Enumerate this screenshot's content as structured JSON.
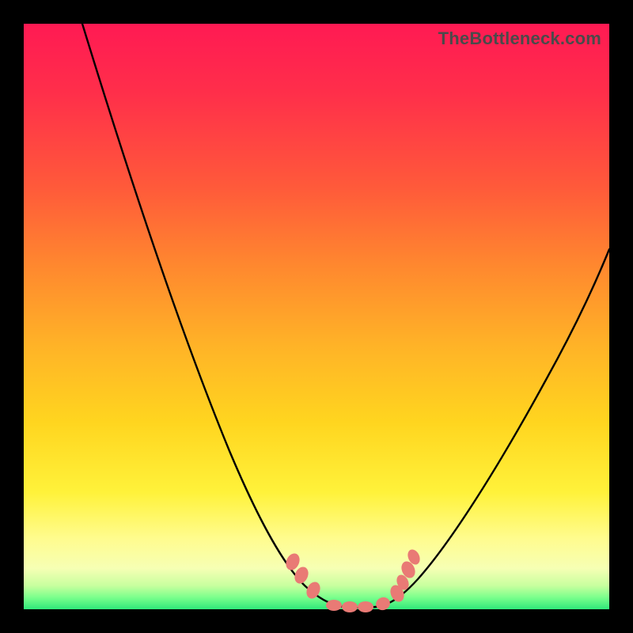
{
  "watermark": "TheBottleneck.com",
  "colors": {
    "frame": "#000000",
    "gradient_top": "#ff1a53",
    "gradient_mid": "#ffd51f",
    "gradient_bottom": "#30e87a",
    "curve": "#000000",
    "markers": "#e97a75"
  },
  "chart_data": {
    "type": "line",
    "title": "",
    "xlabel": "",
    "ylabel": "",
    "xlim": [
      0,
      100
    ],
    "ylim": [
      0,
      100
    ],
    "grid": false,
    "legend": false,
    "series": [
      {
        "name": "bottleneck-curve",
        "x": [
          10,
          15,
          20,
          25,
          30,
          35,
          40,
          45,
          48,
          50,
          52,
          55,
          58,
          60,
          65,
          70,
          75,
          80,
          85,
          90,
          95,
          100
        ],
        "y": [
          100,
          88,
          75,
          62,
          49,
          36,
          24,
          14,
          8,
          3,
          1,
          0,
          0,
          1,
          4,
          10,
          18,
          27,
          37,
          47,
          56,
          64
        ]
      }
    ],
    "markers": {
      "name": "highlight-points",
      "x": [
        45,
        46.5,
        49,
        52,
        55,
        58,
        60,
        61.5,
        62.5
      ],
      "y": [
        9,
        6,
        2,
        0.5,
        0.2,
        0.5,
        2,
        5,
        8
      ]
    },
    "note": "x/y are percentages of the inner plot area; y=0 is the bottom (green) edge, y=100 is the top edge. Values are estimated from pixel positions."
  }
}
